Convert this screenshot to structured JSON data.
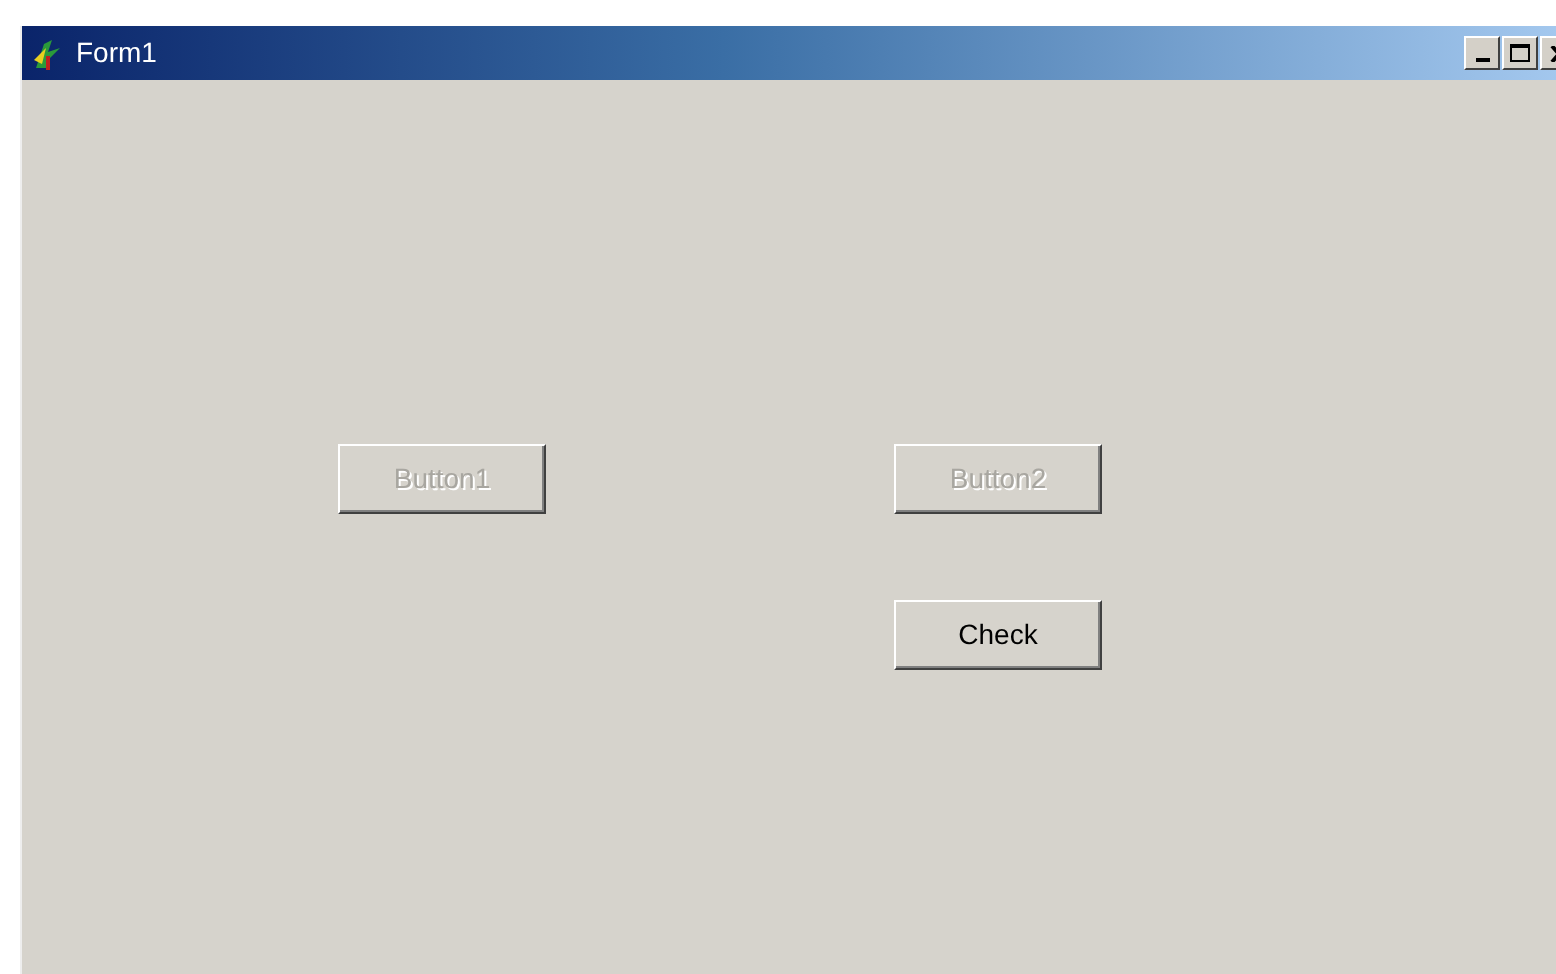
{
  "window": {
    "title": "Form1"
  },
  "buttons": [
    {
      "label": "Button1",
      "disabled": true
    },
    {
      "label": "Button2",
      "disabled": true
    },
    {
      "label": "Check",
      "disabled": false
    }
  ]
}
